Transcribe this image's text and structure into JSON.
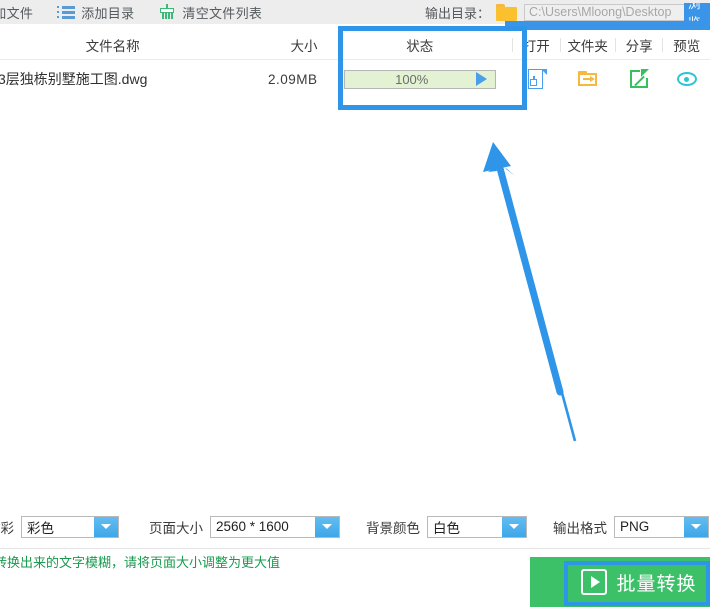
{
  "toolbar": {
    "add_file_label": "添加文件",
    "add_dir_label": "添加目录",
    "clear_list_label": "清空文件列表",
    "output_dir_label": "输出目录：",
    "output_dir_value": "C:\\Users\\Mloong\\Desktop",
    "browse_label": "浏览"
  },
  "table": {
    "headers": {
      "name": "文件名称",
      "size": "大小",
      "status": "状态",
      "open": "打开",
      "folder": "文件夹",
      "share": "分享",
      "preview": "预览"
    },
    "rows": [
      {
        "name": "3层独栋别墅施工图.dwg",
        "size": "2.09MB",
        "progress_text": "100%",
        "progress_percent": 100
      }
    ]
  },
  "options": {
    "color_label": "输出色彩",
    "color_value": "彩色",
    "pagesize_label": "页面大小",
    "pagesize_value": "2560 * 1600",
    "bgcolor_label": "背景颜色",
    "bgcolor_value": "白色",
    "format_label": "输出格式",
    "format_value": "PNG"
  },
  "footer": {
    "hint": "转换出来的文字模糊，请将页面大小调整为更大值",
    "convert_label": "批量转换"
  },
  "colors": {
    "accent_blue": "#3a94e8",
    "annotation_blue": "#2e95e8",
    "green": "#3cc168",
    "hint_green": "#1a9a4f",
    "progress_fill": "#e2f2d2"
  }
}
